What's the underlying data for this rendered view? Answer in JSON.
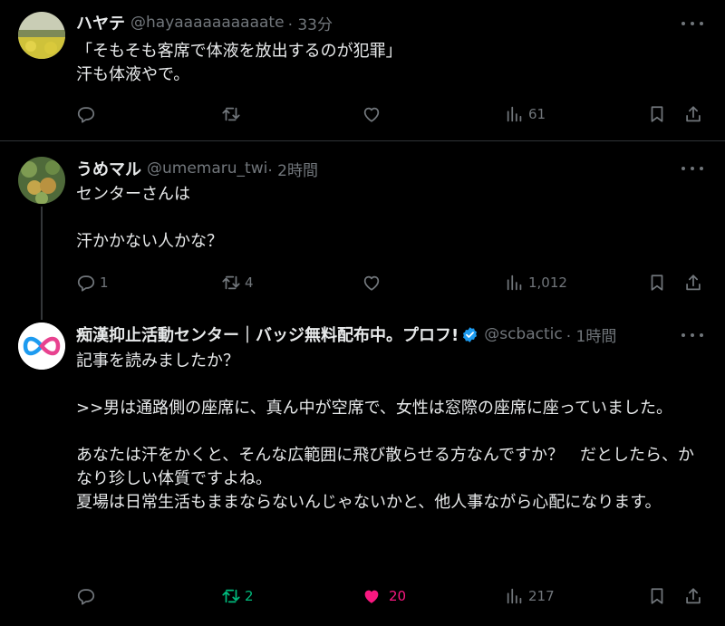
{
  "tweets": [
    {
      "name": "ハヤテ",
      "handle": "@hayaaaaaaaaaate",
      "time": "· 33分",
      "text": "「そもそも客席で体液を放出するのが犯罪」\n汗も体液やで。",
      "replies": "",
      "retweets": "",
      "likes": "",
      "views": "61"
    },
    {
      "name": "うめマル",
      "handle": "@umemaru_twi",
      "time": " · 2時間",
      "text": "センターさんは\n\n汗かかない人かな？",
      "replies": "1",
      "retweets": "4",
      "likes": "",
      "views": "1,012"
    },
    {
      "name": "痴漢抑止活動センター｜バッジ無料配布中。プロフ!",
      "handle": "@scbactic",
      "time": "· 1時間",
      "text": "記事を読みましたか？\n\n>>男は通路側の座席に、真ん中が空席で、女性は窓際の座席に座っていました。\n\nあなたは汗をかくと、そんな広範囲に飛び散らせる方なんですか？　だとしたら、かなり珍しい体質ですよね。\n夏場は日常生活もままならないんじゃないかと、他人事ながら心配になります。",
      "replies": "",
      "retweets": "2",
      "likes": "20",
      "views": "217"
    }
  ],
  "colors": {
    "retweet_active": "#00ba7c",
    "like_active": "#f91880",
    "verified": "#1d9bf0"
  },
  "icons": [
    "reply-icon",
    "retweet-icon",
    "like-icon",
    "views-icon",
    "bookmark-icon",
    "share-icon",
    "more-icon",
    "verified-badge-icon"
  ]
}
